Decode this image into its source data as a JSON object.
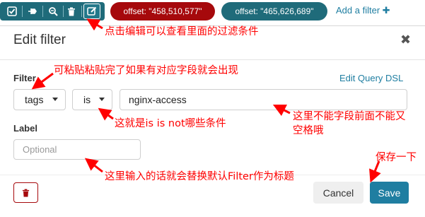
{
  "toolbar": {
    "icons": [
      "checkbox-icon",
      "pin-icon",
      "zoom-icon",
      "trash-icon",
      "edit-icon"
    ]
  },
  "filters": [
    {
      "label": "offset: \"458,510,577\"",
      "color": "#a6090c"
    },
    {
      "label": "offset: \"465,626,689\"",
      "color": "#1f6b7a"
    }
  ],
  "add_filter": {
    "label": "Add a filter",
    "icon": "plus-icon"
  },
  "modal": {
    "title": "Edit filter",
    "close_icon": "close-icon",
    "filter_label": "Filter",
    "edit_dsl": "Edit Query DSL",
    "field_value": "tags",
    "operator_value": "is",
    "value_input": "nginx-access",
    "label_label": "Label",
    "label_placeholder": "Optional",
    "delete_icon": "trash-icon",
    "cancel": "Cancel",
    "save": "Save"
  },
  "annotations": {
    "edit": "点击编辑可以查看里面的过滤条件",
    "paste": "可粘贴粘贴完了如果有对应字段就会出现",
    "operator": "这就是is  is not哪些条件",
    "value_1": "这里不能字段前面不能又",
    "value_2": "空格哦",
    "label": "这里输入的话就会替换默认Filter作为标题",
    "save": "保存一下"
  },
  "colors": {
    "annotation": "#ff0000",
    "accent": "#1f7ea1",
    "danger": "#a6090c"
  }
}
